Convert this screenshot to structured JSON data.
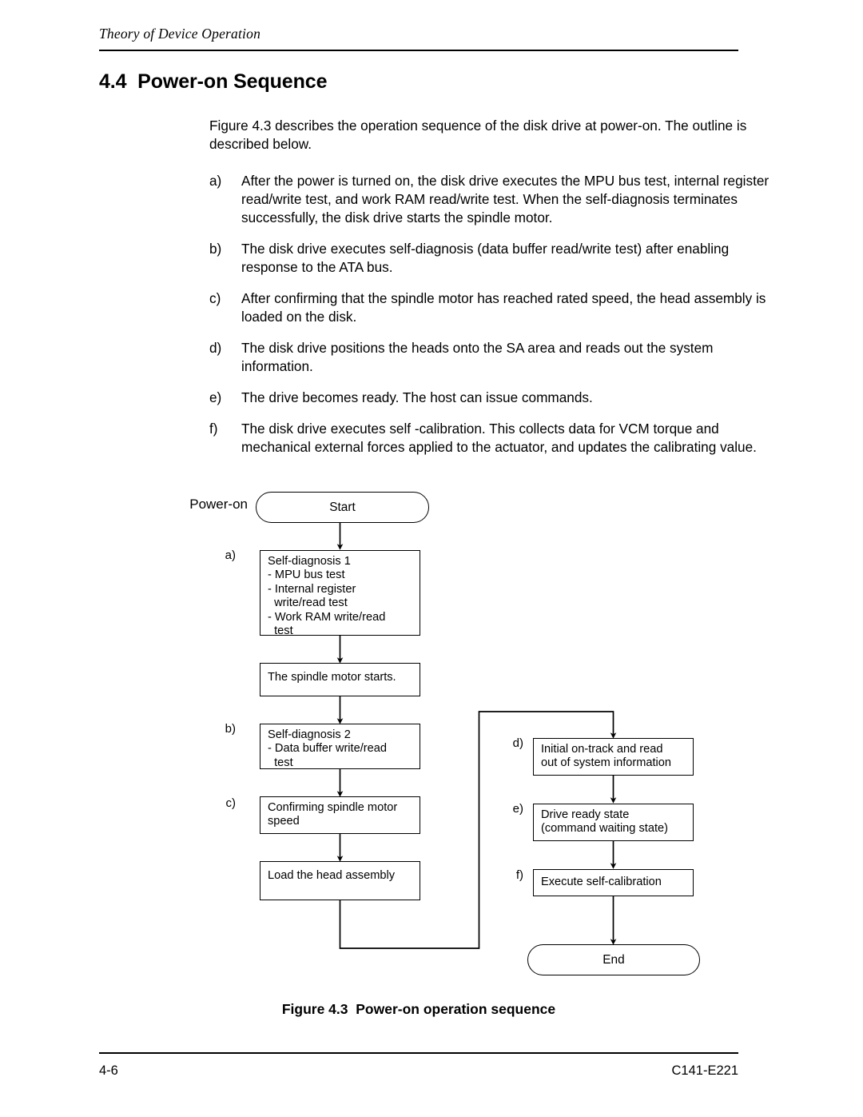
{
  "page": {
    "running_head": "Theory of Device Operation",
    "section_number": "4.4",
    "section_title": "Power-on Sequence",
    "heading_full": "4.4  Power-on Sequence"
  },
  "body": {
    "intro": "Figure 4.3 describes the operation sequence of the disk drive at power-on.  The outline is described below.",
    "items": [
      {
        "marker": "a)",
        "text": "After the power is turned on, the disk drive executes the MPU bus test, internal register read/write test, and work RAM read/write test.  When the self-diagnosis terminates successfully, the disk drive starts the spindle motor."
      },
      {
        "marker": "b)",
        "text": "The disk drive executes self-diagnosis (data buffer read/write test) after enabling response to the ATA bus."
      },
      {
        "marker": "c)",
        "text": "After confirming that the spindle motor has reached rated speed, the head assembly is loaded on the disk."
      },
      {
        "marker": "d)",
        "text": "The disk drive positions the heads onto the SA area and reads out the system information."
      },
      {
        "marker": "e)",
        "text": "The drive becomes ready.  The host can issue commands."
      },
      {
        "marker": "f)",
        "text": "The disk drive executes self -calibration.  This collects data for VCM torque and mechanical external forces applied to the actuator, and updates the calibrating value."
      }
    ]
  },
  "flowchart": {
    "power_on_label": "Power-on",
    "start_node": "Start",
    "end_node": "End",
    "step_labels": {
      "a": "a)",
      "b": "b)",
      "c": "c)",
      "d": "d)",
      "e": "e)",
      "f": "f)"
    },
    "boxes": {
      "self_diagnosis_1": "Self-diagnosis 1\n- MPU bus test\n- Internal register\n  write/read test\n- Work RAM write/read\n  test",
      "spindle_starts": "The spindle motor starts.",
      "self_diagnosis_2": "Self-diagnosis 2\n- Data buffer write/read\n  test",
      "confirm_speed": "Confirming spindle motor\nspeed",
      "load_head": "Load the head assembly",
      "initial_on_track": "Initial on-track and read\nout of system information",
      "drive_ready": "Drive ready state\n(command waiting state)",
      "self_calibration": "Execute self-calibration"
    },
    "line_color": "#000000"
  },
  "figure": {
    "caption": "Figure 4.3  Power-on operation sequence"
  },
  "footer": {
    "page_number": "4-6",
    "document_id": "C141-E221"
  }
}
